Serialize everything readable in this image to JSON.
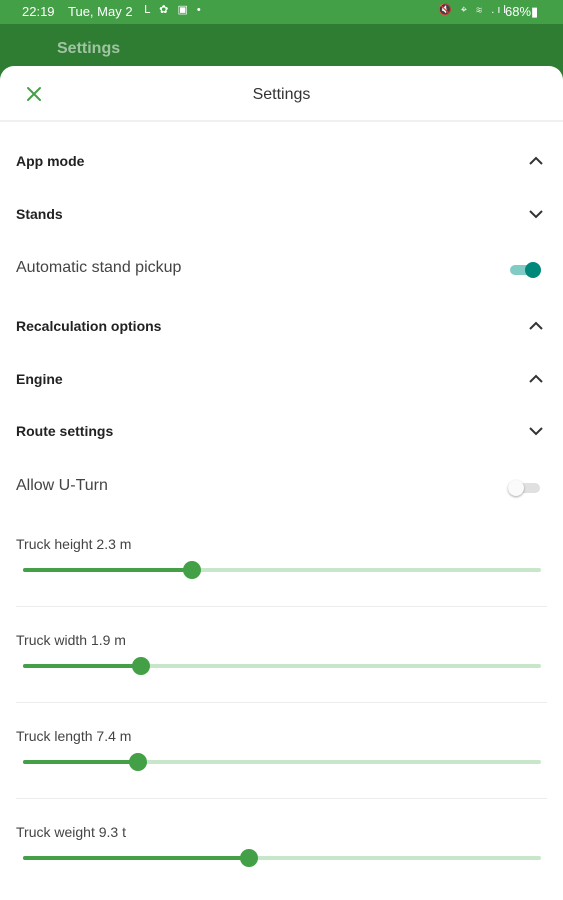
{
  "status_bar": {
    "time": "22:19",
    "date": "Tue, May 2",
    "left_icons": "ᒪ ✿ ▣ •",
    "right_icons": "🔇 ⌖ ≋ .ıl",
    "battery": "68%▮"
  },
  "appbar": {
    "title": "Settings"
  },
  "sheet": {
    "title": "Settings",
    "close_icon": "close-icon"
  },
  "sections": {
    "app_mode": {
      "label": "App mode",
      "expanded": true
    },
    "stands": {
      "label": "Stands",
      "expanded": false
    },
    "automatic_stand_pickup": {
      "label": "Automatic stand pickup",
      "on": true
    },
    "recalculation": {
      "label": "Recalculation options",
      "expanded": true
    },
    "engine": {
      "label": "Engine",
      "expanded": true
    },
    "route_settings": {
      "label": "Route settings",
      "expanded": false
    },
    "allow_uturn": {
      "label": "Allow U-Turn",
      "on": false
    }
  },
  "sliders": [
    {
      "label": "Truck height 2.3 m",
      "fraction": 0.327
    },
    {
      "label": "Truck width 1.9 m",
      "fraction": 0.227
    },
    {
      "label": "Truck length 7.4 m",
      "fraction": 0.222
    },
    {
      "label": "Truck weight 9.3 t",
      "fraction": 0.437
    }
  ],
  "colors": {
    "accent": "#43a047",
    "appbar": "#2e7d32",
    "toggle_on": "#00897b"
  }
}
